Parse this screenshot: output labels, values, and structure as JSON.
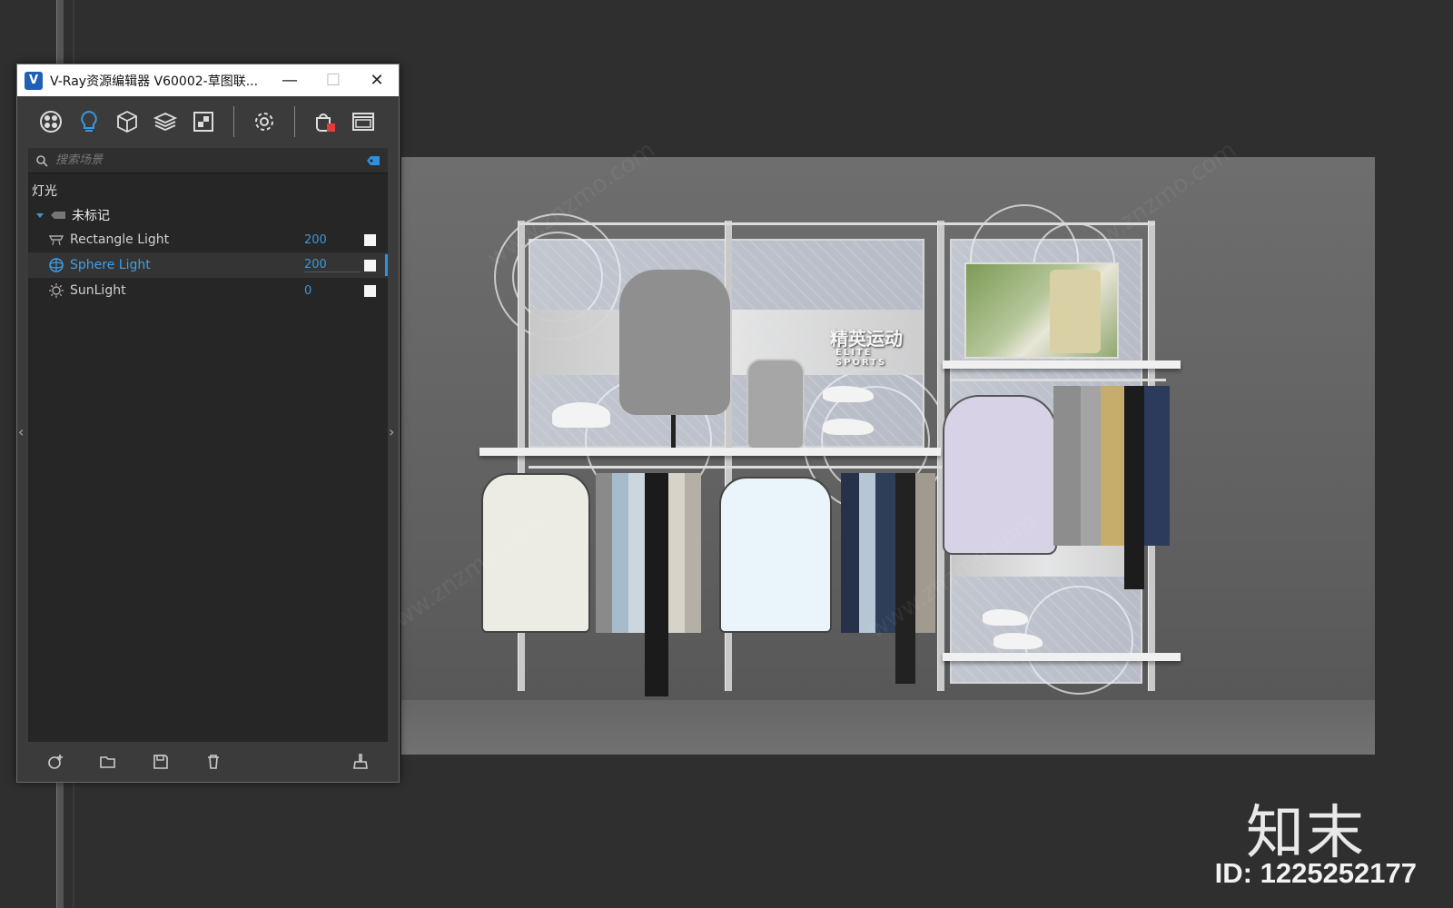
{
  "window": {
    "title": "V-Ray资源编辑器 V60002-草图联...",
    "app_icon_letter": "V",
    "minimize": "—",
    "maximize": "☐",
    "close": "✕"
  },
  "toolbar": {
    "items": [
      "materials-icon",
      "lights-icon",
      "geometry-icon",
      "layers-icon",
      "render-elements-icon",
      "settings-icon",
      "render-icon",
      "frame-buffer-icon"
    ]
  },
  "search": {
    "placeholder": "搜索场景"
  },
  "outliner": {
    "section": "灯光",
    "group": "未标记",
    "lights": [
      {
        "name": "Rectangle Light",
        "value": "200",
        "selected": false
      },
      {
        "name": "Sphere Light",
        "value": "200",
        "selected": true
      },
      {
        "name": "SunLight",
        "value": "0",
        "selected": false
      }
    ]
  },
  "bottom_bar": [
    "add-icon",
    "open-folder-icon",
    "save-icon",
    "delete-icon",
    "purge-icon"
  ],
  "viewport": {
    "sign_main": "精英运动",
    "sign_sub": "ELITE SPORTS"
  },
  "watermark": {
    "brand": "知末",
    "id": "ID: 1225252177",
    "repeat": "www.znzmo.com"
  },
  "colors": {
    "accent": "#3a97dc",
    "panel_bg": "#262626",
    "window_bg": "#3b3b3b"
  }
}
